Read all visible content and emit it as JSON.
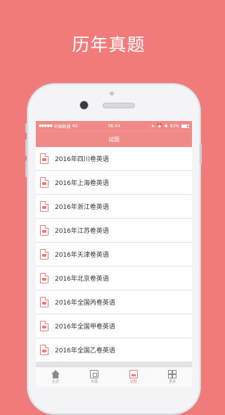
{
  "banner": {
    "title": "历年真题"
  },
  "status_bar": {
    "carrier": "中国联通",
    "network": "4G",
    "time": "08:44",
    "battery": "82%"
  },
  "nav": {
    "title": "试题"
  },
  "exam_list": [
    {
      "label": "2016年四川卷英语"
    },
    {
      "label": "2016年上海卷英语"
    },
    {
      "label": "2016年浙江卷英语"
    },
    {
      "label": "2016年江苏卷英语"
    },
    {
      "label": "2016年天津卷英语"
    },
    {
      "label": "2016年北京卷英语"
    },
    {
      "label": "2016年全国丙卷英语"
    },
    {
      "label": "2016年全国甲卷英语"
    },
    {
      "label": "2016年全国乙卷英语"
    }
  ],
  "tab_bar": {
    "tabs": [
      {
        "label": "主页",
        "icon": "home-icon"
      },
      {
        "label": "专题",
        "icon": "topic-icon"
      },
      {
        "label": "试题",
        "icon": "exam-icon",
        "active": true
      },
      {
        "label": "更多",
        "icon": "grid-icon"
      }
    ]
  },
  "colors": {
    "accent": "#f07b7a",
    "nav": "#f08a87"
  }
}
